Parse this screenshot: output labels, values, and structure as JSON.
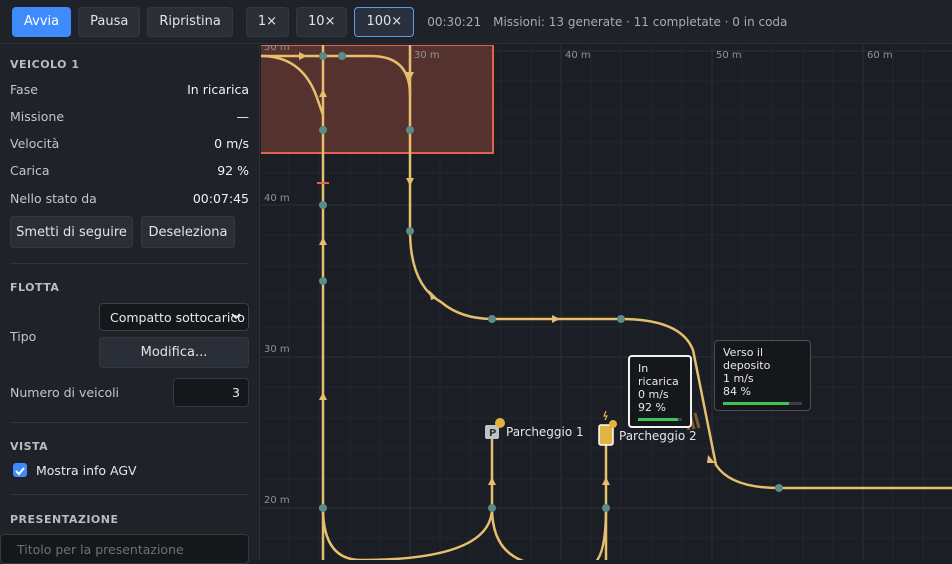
{
  "toolbar": {
    "start": "Avvia",
    "pause": "Pausa",
    "reset": "Ripristina",
    "speeds": [
      "1×",
      "10×",
      "100×"
    ],
    "active_speed": "100×",
    "clock": "00:30:21",
    "missions": "Missioni: 13 generate · 11 completate · 0 in coda"
  },
  "vehicle": {
    "title": "VEICOLO 1",
    "fields": [
      {
        "label": "Fase",
        "value": "In ricarica"
      },
      {
        "label": "Missione",
        "value": "—"
      },
      {
        "label": "Velocità",
        "value": "0 m/s"
      },
      {
        "label": "Carica",
        "value": "92 %"
      },
      {
        "label": "Nello stato da",
        "value": "00:07:45"
      }
    ],
    "unfollow": "Smetti di seguire",
    "deselect": "Deseleziona"
  },
  "fleet": {
    "title": "FLOTTA",
    "type_label": "Tipo",
    "type_value": "Compatto sottocarico",
    "modify": "Modifica...",
    "count_label": "Numero di veicoli",
    "count_value": "3"
  },
  "view": {
    "title": "VISTA",
    "show_info": "Mostra info AGV",
    "show_info_checked": true
  },
  "presentation": {
    "title": "PRESENTAZIONE",
    "placeholder": "Titolo per la presentazione"
  },
  "map": {
    "x_labels": [
      "30 m",
      "40 m",
      "50 m",
      "60 m",
      "30 m"
    ],
    "y_labels": [
      "50 m",
      "40 m",
      "30 m",
      "20 m"
    ],
    "parking": [
      "Parcheggio 1",
      "Parcheggio 2"
    ],
    "agvs": [
      {
        "state": "In ricarica",
        "speed": "0 m/s",
        "charge": "92 %",
        "charge_value": 0.92,
        "selected": true
      },
      {
        "state": "Verso il deposito",
        "speed": "1 m/s",
        "charge": "84 %",
        "charge_value": 0.84,
        "selected": false
      }
    ],
    "colors": {
      "path": "#e5bf6e",
      "node": "#5a8a8a",
      "zone_fill": "#6a3a30",
      "zone_border": "#e0634f",
      "battery": "#41c456"
    }
  }
}
